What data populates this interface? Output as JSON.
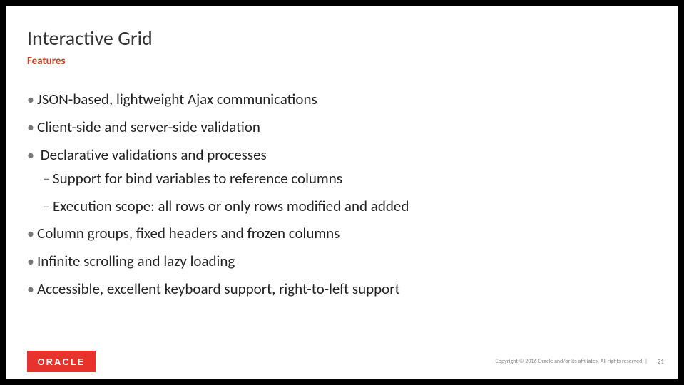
{
  "title": "Interactive Grid",
  "subtitle": "Features",
  "bullets": [
    "JSON-based, lightweight Ajax communications",
    "Client-side and server-side validation",
    "Declarative validations and processes"
  ],
  "sub_bullets": [
    "Support for bind variables to reference columns",
    "Execution scope: all rows or only rows modified and added"
  ],
  "bullets_after": [
    "Column groups, fixed headers and frozen columns",
    "Infinite scrolling and lazy loading",
    "Accessible, excellent keyboard support, right-to-left support"
  ],
  "logo_text": "ORACLE",
  "copyright": "Copyright © 2016 Oracle and/or its affiliates. All rights reserved.  |",
  "page_number": "21"
}
